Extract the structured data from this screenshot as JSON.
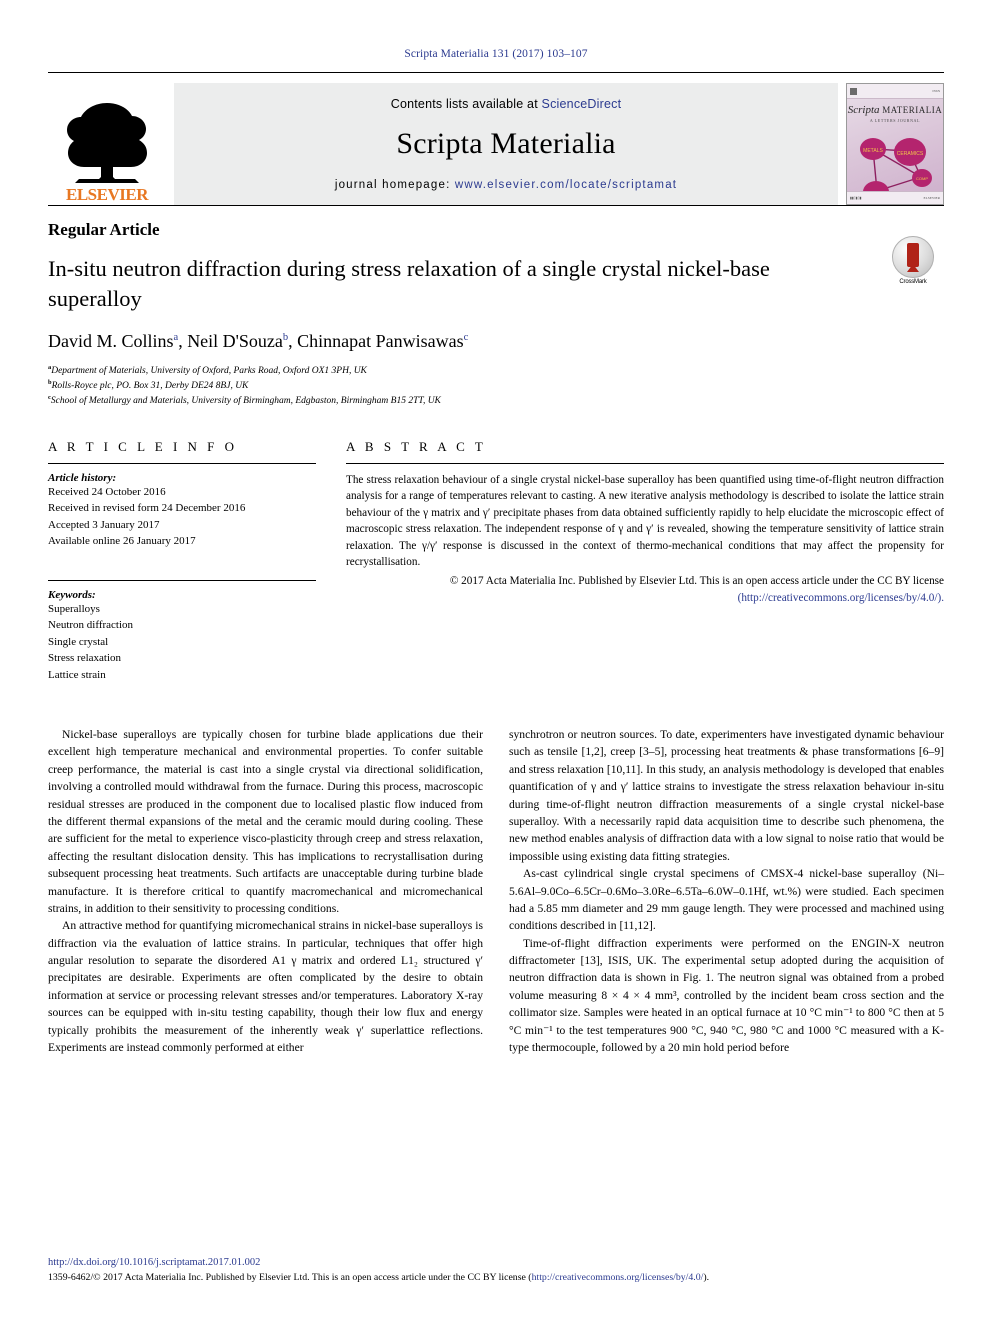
{
  "running_head": "Scripta Materialia 131 (2017) 103–107",
  "masthead": {
    "publisher_name": "ELSEVIER",
    "contents_prefix": "Contents lists available at ",
    "contents_link": "ScienceDirect",
    "journal_title": "Scripta Materialia",
    "homepage_prefix": "journal homepage: ",
    "homepage_link": "www.elsevier.com/locate/scriptamat",
    "cover_title_1": "Scripta",
    "cover_title_2": "MATERIALIA",
    "cover_subtitle": "A LETTERS JOURNAL"
  },
  "article": {
    "type_label": "Regular Article",
    "title": "In-situ neutron diffraction during stress relaxation of a single crystal nickel-base superalloy",
    "crossmark_label": "CrossMark",
    "authors": [
      {
        "name": "David M. Collins",
        "sup": "a"
      },
      {
        "name": "Neil D'Souza",
        "sup": "b"
      },
      {
        "name": "Chinnapat Panwisawas",
        "sup": "c"
      }
    ],
    "affiliations": [
      {
        "sup": "a",
        "text": "Department of Materials, University of Oxford, Parks Road, Oxford OX1 3PH, UK"
      },
      {
        "sup": "b",
        "text": "Rolls-Royce plc, PO. Box 31, Derby DE24 8BJ, UK"
      },
      {
        "sup": "c",
        "text": "School of Metallurgy and Materials, University of Birmingham, Edgbaston, Birmingham B15 2TT, UK"
      }
    ]
  },
  "article_info": {
    "heading": "A R T I C L E   I N F O",
    "history_title": "Article history:",
    "history": [
      "Received 24 October 2016",
      "Received in revised form 24 December 2016",
      "Accepted 3 January 2017",
      "Available online 26 January 2017"
    ],
    "keywords_title": "Keywords:",
    "keywords": [
      "Superalloys",
      "Neutron diffraction",
      "Single crystal",
      "Stress relaxation",
      "Lattice strain"
    ]
  },
  "abstract": {
    "heading": "A B S T R A C T",
    "text": "The stress relaxation behaviour of a single crystal nickel-base superalloy has been quantified using time-of-flight neutron diffraction analysis for a range of temperatures relevant to casting. A new iterative analysis methodology is described to isolate the lattice strain behaviour of the γ matrix and γ′ precipitate phases from data obtained sufficiently rapidly to help elucidate the microscopic effect of macroscopic stress relaxation. The independent response of γ and γ′ is revealed, showing the temperature sensitivity of lattice strain relaxation. The γ/γ′ response is discussed in the context of thermo-mechanical conditions that may affect the propensity for recrystallisation.",
    "copyright": "© 2017 Acta Materialia Inc. Published by Elsevier Ltd. This is an open access article under the CC BY license",
    "license_url": "(http://creativecommons.org/licenses/by/4.0/)."
  },
  "body": {
    "left_column": [
      "Nickel-base superalloys are typically chosen for turbine blade applications due their excellent high temperature mechanical and environmental properties. To confer suitable creep performance, the material is cast into a single crystal via directional solidification, involving a controlled mould withdrawal from the furnace. During this process, macroscopic residual stresses are produced in the component due to localised plastic flow induced from the different thermal expansions of the metal and the ceramic mould during cooling. These are sufficient for the metal to experience visco-plasticity through creep and stress relaxation, affecting the resultant dislocation density. This has implications to recrystallisation during subsequent processing heat treatments. Such artifacts are unacceptable during turbine blade manufacture. It is therefore critical to quantify macromechanical and micromechanical strains, in addition to their sensitivity to processing conditions.",
      "An attractive method for quantifying micromechanical strains in nickel-base superalloys is diffraction via the evaluation of lattice strains. In particular, techniques that offer high angular resolution to separate the disordered A1 γ matrix and ordered L1₂ structured γ′ precipitates are desirable. Experiments are often complicated by the desire to obtain information at service or processing relevant stresses and/or temperatures. Laboratory X-ray sources can be equipped with in-situ testing capability, though their low flux and energy typically prohibits the measurement of the inherently weak γ′ superlattice reflections. Experiments are instead commonly performed at either"
    ],
    "right_column": [
      "synchrotron or neutron sources. To date, experimenters have investigated dynamic behaviour such as tensile [1,2], creep [3–5], processing heat treatments & phase transformations [6–9] and stress relaxation [10,11]. In this study, an analysis methodology is developed that enables quantification of γ and γ′ lattice strains to investigate the stress relaxation behaviour in-situ during time-of-flight neutron diffraction measurements of a single crystal nickel-base superalloy. With a necessarily rapid data acquisition time to describe such phenomena, the new method enables analysis of diffraction data with a low signal to noise ratio that would be impossible using existing data fitting strategies.",
      "As-cast cylindrical single crystal specimens of CMSX-4 nickel-base superalloy (Ni–5.6Al–9.0Co–6.5Cr–0.6Mo–3.0Re–6.5Ta–6.0W–0.1Hf, wt.%) were studied. Each specimen had a 5.85 mm diameter and 29 mm gauge length. They were processed and machined using conditions described in [11,12].",
      "Time-of-flight diffraction experiments were performed on the ENGIN-X neutron diffractometer [13], ISIS, UK. The experimental setup adopted during the acquisition of neutron diffraction data is shown in Fig. 1. The neutron signal was obtained from a probed volume measuring 8 × 4 × 4 mm³, controlled by the incident beam cross section and the collimator size. Samples were heated in an optical furnace at 10 °C min⁻¹ to 800 °C then at 5 °C min⁻¹ to the test temperatures 900 °C, 940 °C, 980 °C and 1000 °C measured with a K-type thermocouple, followed by a 20 min hold period before"
    ]
  },
  "footer": {
    "doi": "http://dx.doi.org/10.1016/j.scriptamat.2017.01.002",
    "copyright_prefix": "1359-6462/© 2017 Acta Materialia Inc. Published by Elsevier Ltd. This is an open access article under the CC BY license (",
    "copyright_link": "http://creativecommons.org/licenses/by/4.0/",
    "copyright_suffix": ")."
  },
  "colors": {
    "link": "#2b3a8f",
    "elsevier_orange": "#e87722",
    "masthead_bg": "#eceded"
  }
}
